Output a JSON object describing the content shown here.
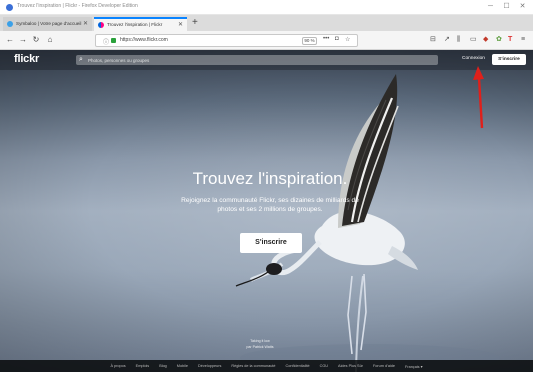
{
  "window": {
    "title": "Trouvez l'inspiration | Flickr - Firefox Developer Edition"
  },
  "tabs": [
    {
      "label": "Symbaloo | Votre page d'accueil"
    },
    {
      "label": "Trouvez l'inspiration | Flickr"
    }
  ],
  "toolbar": {
    "url": "https://www.flickr.com",
    "zoom": "90 %"
  },
  "flickr": {
    "logo": "flickr",
    "search_placeholder": "Photos, personnes ou groupes",
    "login_label": "Connexion",
    "signup_label": "S'inscrire"
  },
  "hero": {
    "title": "Trouvez l'inspiration.",
    "subtitle": "Rejoignez la communauté Flickr, ses dizaines de milliards de photos et ses 2 millions de groupes.",
    "cta_label": "S'inscrire"
  },
  "credit": {
    "line1": "Taking it low",
    "line2": "par Patrick Watts"
  },
  "footer": {
    "links": [
      "À propos",
      "Emplois",
      "Blog",
      "Mobile",
      "Développeurs",
      "Règles de la communauté",
      "Confidentialité",
      "CGU",
      "Aides Plus Sûr",
      "Forum d'aide",
      "Français ▾"
    ]
  },
  "colors": {
    "accent_tab": "#0a84ff",
    "annotation_arrow": "#e0201b"
  },
  "icons": {
    "reload": "reload-icon",
    "home": "home-icon",
    "search": "search-icon",
    "bookmark": "star-icon"
  }
}
